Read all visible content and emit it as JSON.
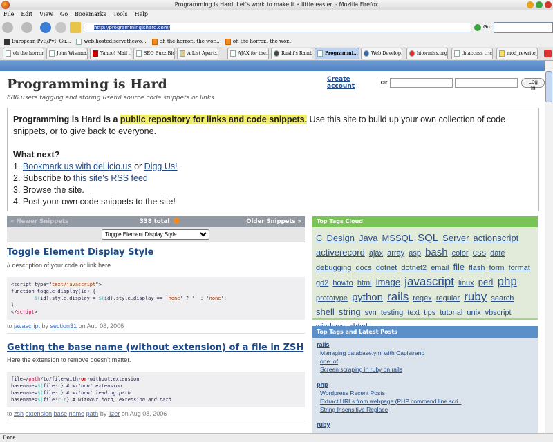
{
  "window": {
    "title": "Programming is Hard. Let's work to make it a little easier. - Mozilla Firefox"
  },
  "menu": [
    "File",
    "Edit",
    "View",
    "Go",
    "Bookmarks",
    "Tools",
    "Help"
  ],
  "nav": {
    "url": "http://programmingishard.com/",
    "go_label": "Go"
  },
  "bookmarks": [
    "European PvE/PvP Gu...",
    "web.hosted.servethewo...",
    "oh the horror.. the wor...",
    "oh the horror.. the wor..."
  ],
  "tabs": [
    "oh the horror...",
    "John Wisema...",
    "Yahoo! Mail ...",
    "SEO Buzz Blo...",
    "A List Apart:...",
    "AJAX for the...",
    "Rushi's Rambl...",
    "Programmi...",
    "Web Develop...",
    "hitormiss.org:...",
    ".htaccess tric...",
    "mod_rewrite_..."
  ],
  "site": {
    "title": "Programming is Hard",
    "subtitle": "686 users tagging and storing useful source code snippets or links",
    "create_account": "Create account",
    "or": "or",
    "login_button": "Log In"
  },
  "intro": {
    "lead": "Programming is Hard is a ",
    "highlight": "public repository for links and code snippets.",
    "rest": " Use this site to build up your own collection of code snippets, or to give back to everyone.",
    "what_next": "What next?",
    "s1_pre": "1. ",
    "s1_link1": "Bookmark us with del.icio.us",
    "s1_mid": " or ",
    "s1_link2": "Digg Us!",
    "s2_pre": "2. Subscribe to ",
    "s2_link": "this site's RSS feed",
    "s3": "3. Browse the site.",
    "s4": "4. Post your own code snippets to the site!"
  },
  "snippets_nav": {
    "newer": "« Newer Snippets",
    "total": "338 total",
    "older": "Older Snippets »",
    "select_value": "Toggle Element Display Style"
  },
  "snippets": [
    {
      "title": "Toggle Element Display Style",
      "desc": "// description of your code or link here",
      "tags": [
        "javascript"
      ],
      "author": "section31",
      "date": "Aug 08, 2006"
    },
    {
      "title": "Getting the base name (without extension) of a file in ZSH",
      "desc": "Here the extension to remove doesn't matter.",
      "tags": [
        "zsh",
        "extension",
        "base",
        "name",
        "path"
      ],
      "author": "lizer",
      "date": "Aug 08, 2006"
    }
  ],
  "meta_words": {
    "to": "to ",
    "by": " by ",
    "on": " on "
  },
  "cloud": {
    "title": "Top Tags Cloud",
    "tags": [
      {
        "t": "C",
        "w": 2
      },
      {
        "t": "Design",
        "w": 2
      },
      {
        "t": "Java",
        "w": 2
      },
      {
        "t": "MSSQL",
        "w": 2
      },
      {
        "t": "SQL",
        "w": 3
      },
      {
        "t": "Server",
        "w": 2
      },
      {
        "t": "actionscript",
        "w": 2
      },
      {
        "t": "activerecord",
        "w": 2
      },
      {
        "t": "ajax",
        "w": 1
      },
      {
        "t": "array",
        "w": 1
      },
      {
        "t": "asp",
        "w": 1
      },
      {
        "t": "bash",
        "w": 3
      },
      {
        "t": "color",
        "w": 1
      },
      {
        "t": "css",
        "w": 2
      },
      {
        "t": "date",
        "w": 1
      },
      {
        "t": "debugging",
        "w": 1
      },
      {
        "t": "docs",
        "w": 1
      },
      {
        "t": "dotnet",
        "w": 1
      },
      {
        "t": "dotnet2",
        "w": 1
      },
      {
        "t": "email",
        "w": 1
      },
      {
        "t": "file",
        "w": 2
      },
      {
        "t": "flash",
        "w": 1
      },
      {
        "t": "form",
        "w": 1
      },
      {
        "t": "format",
        "w": 1
      },
      {
        "t": "gd2",
        "w": 1
      },
      {
        "t": "howto",
        "w": 1
      },
      {
        "t": "html",
        "w": 1
      },
      {
        "t": "image",
        "w": 2
      },
      {
        "t": "javascript",
        "w": 4
      },
      {
        "t": "linux",
        "w": 1
      },
      {
        "t": "perl",
        "w": 2
      },
      {
        "t": "php",
        "w": 4
      },
      {
        "t": "prototype",
        "w": 1
      },
      {
        "t": "python",
        "w": 3
      },
      {
        "t": "rails",
        "w": 4
      },
      {
        "t": "regex",
        "w": 1
      },
      {
        "t": "regular",
        "w": 1
      },
      {
        "t": "ruby",
        "w": 4
      },
      {
        "t": "search",
        "w": 1
      },
      {
        "t": "shell",
        "w": 2
      },
      {
        "t": "string",
        "w": 2
      },
      {
        "t": "svn",
        "w": 1
      },
      {
        "t": "testing",
        "w": 1
      },
      {
        "t": "text",
        "w": 1
      },
      {
        "t": "tips",
        "w": 1
      },
      {
        "t": "tutorial",
        "w": 1
      },
      {
        "t": "unix",
        "w": 1
      },
      {
        "t": "vbscript",
        "w": 1
      },
      {
        "t": "windows",
        "w": 1
      },
      {
        "t": "xhtml",
        "w": 1
      }
    ]
  },
  "latest": {
    "title": "Top Tags and Latest Posts",
    "groups": [
      {
        "tag": "rails",
        "posts": [
          "Managing database.yml with Capistrano",
          "one_of",
          "Screen scraping in ruby on rails"
        ]
      },
      {
        "tag": "php",
        "posts": [
          "Wordpress Recent Posts",
          "Extract URLs from webpage (PHP command line scri..",
          "String Insensitive Replace"
        ]
      },
      {
        "tag": "ruby",
        "posts": []
      }
    ]
  },
  "status": "Done"
}
